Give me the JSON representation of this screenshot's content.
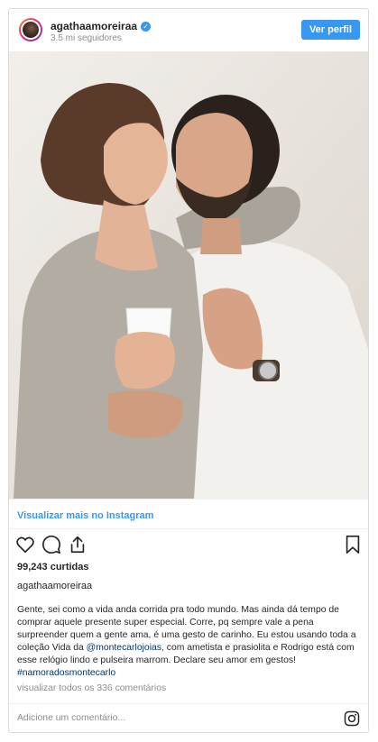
{
  "header": {
    "username": "agathaamoreiraa",
    "followers": "3.5 mi seguidores",
    "view_profile_label": "Ver perfil"
  },
  "post": {
    "view_more_label": "Visualizar mais no Instagram",
    "likes": "99,243 curtidas",
    "owner": "agathaamoreiraa",
    "caption_before_mention": "Gente, sei como a vida anda corrida pra todo mundo. Mas ainda dá tempo de comprar aquele presente super especial. Corre, pq sempre vale a pena surpreender quem a gente ama, é uma gesto de carinho. Eu estou usando toda a coleção Vida da ",
    "mention": "@montecarlojoias",
    "caption_after_mention": ", com ametista e prasiolita e Rodrigo está com esse relógio lindo e pulseira marrom. Declare seu amor em gestos! ",
    "hashtag": "#namoradosmontecarlo",
    "view_comments": "visualizar todos os 336 comentários",
    "comment_placeholder": "Adicione um comentário..."
  },
  "icons": {
    "like": "heart-icon",
    "comment": "comment-icon",
    "share": "share-icon",
    "save": "bookmark-icon",
    "brand": "instagram-icon"
  },
  "colors": {
    "accent": "#3897f0",
    "verified": "#3897f0",
    "link": "#003569",
    "muted": "#8e8e8e"
  }
}
